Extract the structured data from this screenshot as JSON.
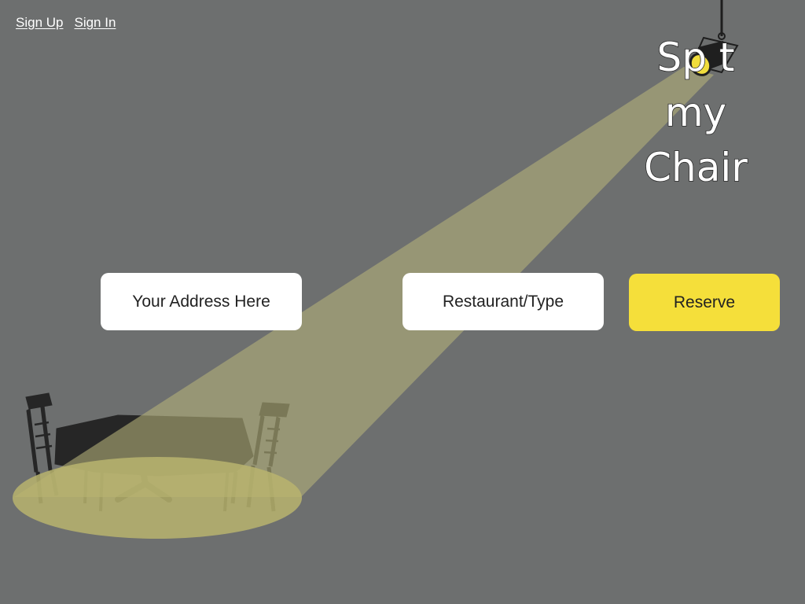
{
  "auth": {
    "sign_up": "Sign Up",
    "sign_in": "Sign In"
  },
  "logo": {
    "line1": "Sp  t",
    "line2": "my",
    "line3": "Chair"
  },
  "search": {
    "address_placeholder": "Your Address Here",
    "restaurant_placeholder": "Restaurant/Type",
    "reserve_label": "Reserve"
  },
  "colors": {
    "background": "#6d6f6f",
    "beam": "#b7b37a",
    "accent": "#f5df3a",
    "silhouette": "#232323"
  },
  "icons": {
    "lamp": "spotlight-icon",
    "scene": "table-and-chairs-illustration"
  }
}
